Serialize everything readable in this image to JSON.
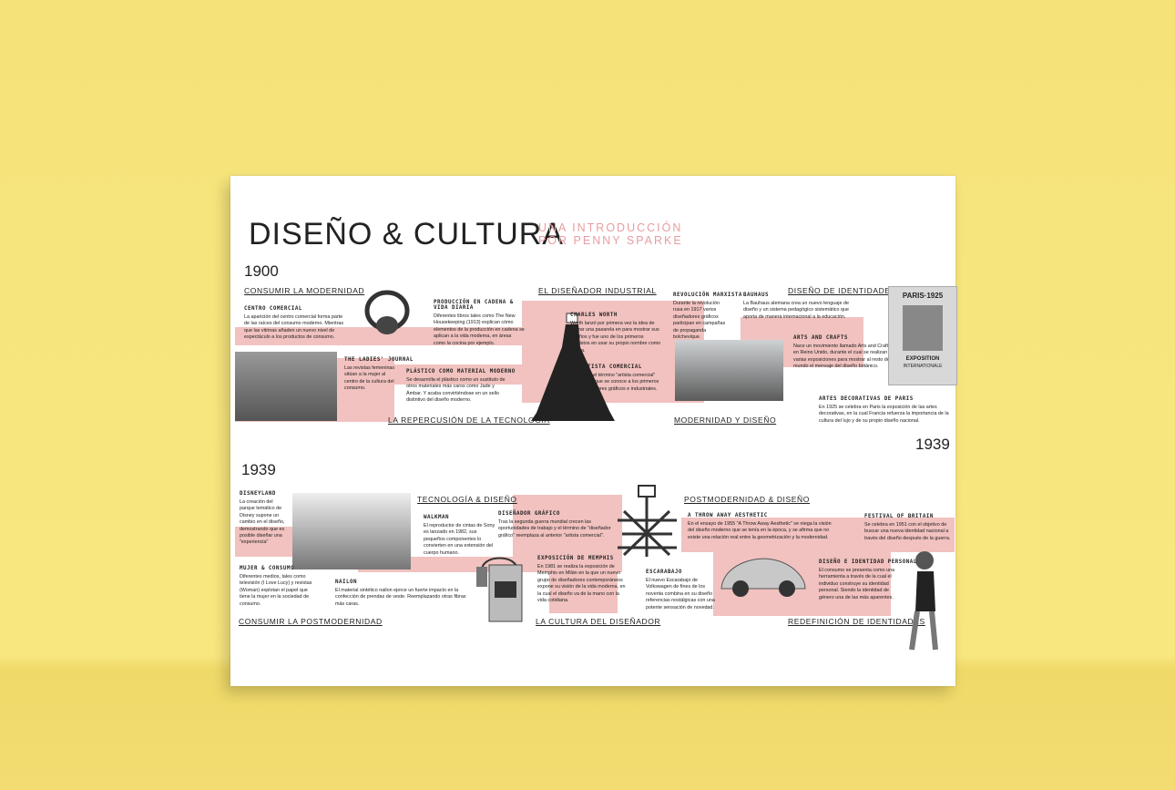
{
  "header": {
    "title": "DISEÑO & CULTURA",
    "subtitle_line1": "UNA INTRODUCCIÓN",
    "subtitle_line2": "POR PENNY SPARKE"
  },
  "top": {
    "year_start": "1900",
    "year_end": "1939",
    "sections": {
      "consumir": "CONSUMIR LA MODERNIDAD",
      "disenador_industrial": "EL DISEÑADOR INDUSTRIAL",
      "identidades": "DISEÑO DE IDENTIDADES",
      "tecnologia": "LA REPERCUSIÓN DE LA TECNOLOGÍA",
      "modernidad": "MODERNIDAD Y DISEÑO"
    },
    "items": {
      "centro": {
        "h": "CENTRO COMERCIAL",
        "p": "La aparición del centro comercial forma parte de las raíces del consumo moderno. Mientras que las vitrinas añaden un nuevo nivel de espectáculo a los productos de consumo."
      },
      "produccion": {
        "h1": "PRODUCCIÓN EN CADENA &",
        "h2": "VIDA DIARIA",
        "p": "Diferentes libros tales como The New Housekeeping (1913) explican cómo elementos de la producción en cadena se aplican a la vida moderna, en áreas como la cocina por ejemplo."
      },
      "ladies": {
        "h": "THE LADIES' JOURNAL",
        "p": "Las revistas femeninas sitúan a la mujer al centro de la cultura del consumo."
      },
      "plastico": {
        "h": "PLÁSTICO COMO MATERIAL MODERNO",
        "p": "Se desarrolla el plástico como un sustituto de otros materiales más caros como Jade y Ámbar. Y acaba convirtiéndose en un sello distintivo del diseño moderno."
      },
      "worth": {
        "h": "CHARLES WORTH",
        "p": "Worth lanzó por primera vez la idea de utilizar una pasarela en para mostrar sus diseños y fue uno de los primeros modistos en usar su propio nombre como marca."
      },
      "artista": {
        "h": "ARTISTA COMERCIAL",
        "p": "Nace el término \"artista comercial\" con el que se conoce a los primeros diseñadores gráficos e industriales."
      },
      "marxista": {
        "h": "REVOLUCIÓN MARXISTA",
        "p": "Durante la revolución rusa en 1917 varios diseñadores gráficos participan en campañas de propaganda bolchevique."
      },
      "bauhaus": {
        "h": "BAUHAUS",
        "p": "La Bauhaus alemana crea un nuevo lenguaje de diseño y un sistema pedagógico sistemático que aporta de manera internacional a la educación."
      },
      "arts": {
        "h": "ARTS AND CRAFTS",
        "p": "Nace un movimiento llamado Arts and Crafts en Reino Unido, durante el cual se realizan varias exposiciones para mostrar al resto del mundo el mensaje del diseño británico."
      },
      "artes": {
        "h": "ARTES DECORATIVAS DE PARIS",
        "p": "En 1925 se celebra en Paris la exposición de las artes decorativas, en la cual Francia refuerza la importancia de la cultura del lujo y de su propio diseño nacional."
      }
    },
    "paris_poster": {
      "line1": "PARIS·1925",
      "line2": "EXPOSITION",
      "line3": "INTERNATIONALE"
    }
  },
  "bottom": {
    "year_start": "1939",
    "sections": {
      "tecnologia": "TECNOLOGÍA & DISEÑO",
      "postmodernidad": "POSTMODERNIDAD & DISEÑO",
      "consumir": "CONSUMIR LA POSTMODERNIDAD",
      "cultura": "LA CULTURA DEL DISEÑADOR",
      "redefinicion": "REDEFINICIÓN DE IDENTIDADES"
    },
    "items": {
      "disneyland": {
        "h": "DISNEYLAND",
        "p": "La creación del parque temático de Disney supone un cambio en el diseño, demostrando que es posible diseñar una \"experiencia\""
      },
      "walkman": {
        "h": "WALKMAN",
        "p": "El reproductor de cintas de Sony es lanzado en 1982, sus pequeños componentes lo convierten en una extensión del cuerpo humano."
      },
      "grafico": {
        "h": "DISEÑADOR GRÁFICO",
        "p": "Tras la segunda guerra mundial crecen las oportunidades de trabajo y el término de \"diseñador gráfico\" reemplaza al anterior \"artista comercial\"."
      },
      "throwaway": {
        "h": "A THROW AWAY AESTHETIC",
        "p": "En el ensayo de 1955 \"A Throw Away Aesthetic\" se niega la visión del diseño moderno que se tenía en la época, y se afirma que no existe una relación real entre la geometrización y la modernidad."
      },
      "britain": {
        "h": "FESTIVAL OF BRITAIN",
        "p": "Se celebra en 1951 con el objetivo de buscar una nueva identidad nacional a través del diseño después de la guerra."
      },
      "mujer": {
        "h": "MUJER & CONSUMO",
        "p": "Diferentes medios, tales como televisión (I Love Lucy) y revistas (Woman) explotan el papel que tiene la mujer en la sociedad de consumo."
      },
      "nailon": {
        "h": "NAILON",
        "p": "El material sintético nailon ejerce un fuerte impacto en la confección de prendas de veste. Reemplazando otras fibras más caras."
      },
      "memphis": {
        "h": "EXPOSICIÓN DE MEMPHIS",
        "p": "En 1981 se realiza la exposición de Memphis en Milán en la que un nuevo grupo de diseñadores contemporáneos expone su visión de la vida moderna, en la cual el diseño va de la mano con la vida cotidiana."
      },
      "escarabajo": {
        "h": "ESCARABAJO",
        "p": "El nuevo Escarabajo de Volkswagen de fines de los noventa combina en su diseño referencias nostálgicas con una potente sensación de novedad."
      },
      "identidad": {
        "h": "DISEÑO E IDENTIDAD PERSONAL",
        "p": "El consumo se presenta como una herramienta a través de la cual el individuo construye su identidad personal. Siendo la identidad de género una de las más aparentes."
      }
    }
  }
}
